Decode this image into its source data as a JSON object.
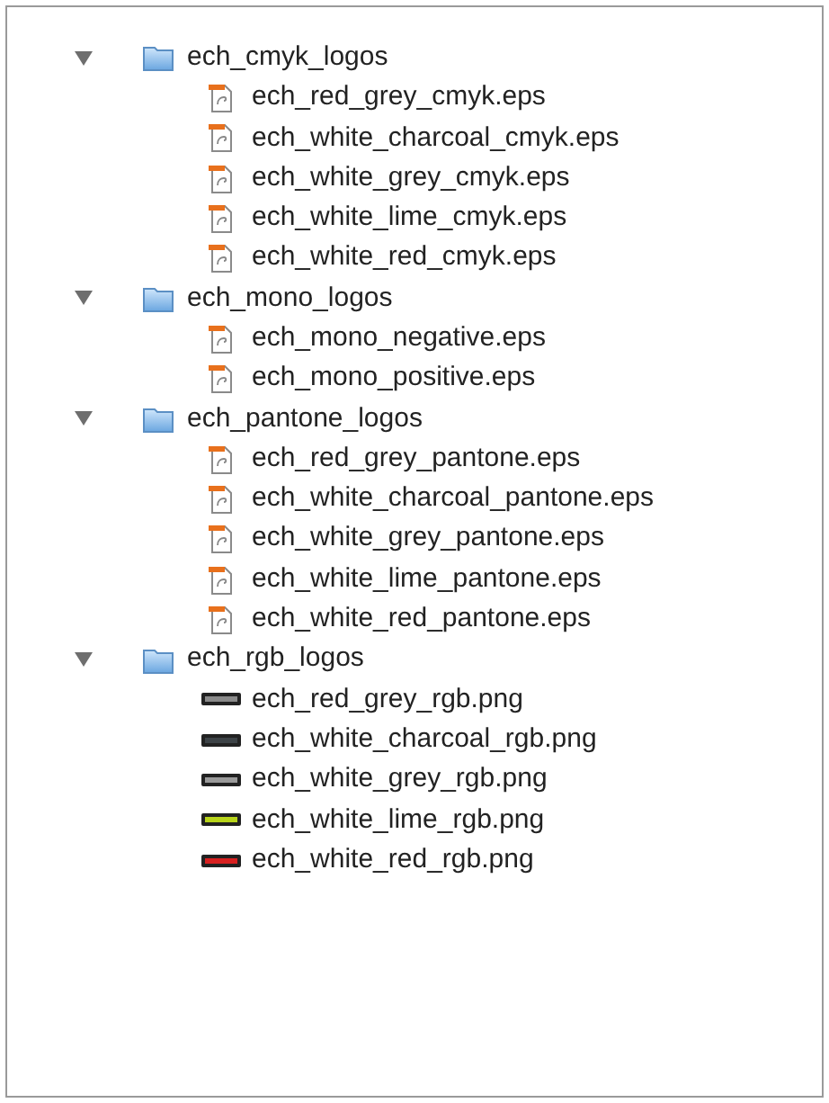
{
  "tree": [
    {
      "name": "ech_cmyk_logos",
      "expanded": true,
      "children": [
        {
          "name": "ech_red_grey_cmyk.eps",
          "kind": "eps"
        },
        {
          "name": "ech_white_charcoal_cmyk.eps",
          "kind": "eps"
        },
        {
          "name": "ech_white_grey_cmyk.eps",
          "kind": "eps"
        },
        {
          "name": "ech_white_lime_cmyk.eps",
          "kind": "eps"
        },
        {
          "name": "ech_white_red_cmyk.eps",
          "kind": "eps"
        }
      ]
    },
    {
      "name": "ech_mono_logos",
      "expanded": true,
      "children": [
        {
          "name": "ech_mono_negative.eps",
          "kind": "eps"
        },
        {
          "name": "ech_mono_positive.eps",
          "kind": "eps"
        }
      ]
    },
    {
      "name": "ech_pantone_logos",
      "expanded": true,
      "children": [
        {
          "name": "ech_red_grey_pantone.eps",
          "kind": "eps"
        },
        {
          "name": "ech_white_charcoal_pantone.eps",
          "kind": "eps"
        },
        {
          "name": "ech_white_grey_pantone.eps",
          "kind": "eps"
        },
        {
          "name": "ech_white_lime_pantone.eps",
          "kind": "eps"
        },
        {
          "name": "ech_white_red_pantone.eps",
          "kind": "eps"
        }
      ]
    },
    {
      "name": "ech_rgb_logos",
      "expanded": true,
      "children": [
        {
          "name": "ech_red_grey_rgb.png",
          "kind": "png",
          "color": "#8a8a8a"
        },
        {
          "name": "ech_white_charcoal_rgb.png",
          "kind": "png",
          "color": "#3d4347"
        },
        {
          "name": "ech_white_grey_rgb.png",
          "kind": "png",
          "color": "#9a9a9a"
        },
        {
          "name": "ech_white_lime_rgb.png",
          "kind": "png",
          "color": "#b8d41a"
        },
        {
          "name": "ech_white_red_rgb.png",
          "kind": "png",
          "color": "#d82020"
        }
      ]
    }
  ]
}
